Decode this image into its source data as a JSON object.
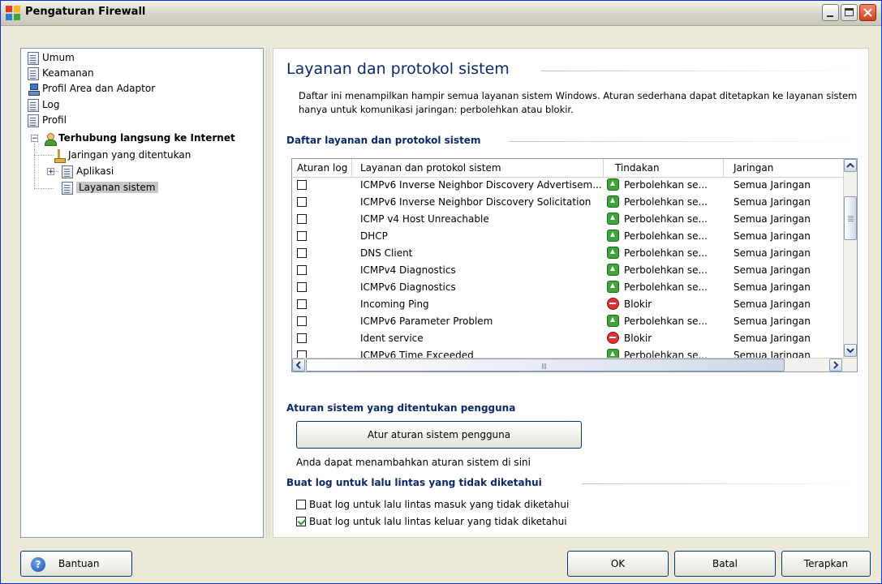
{
  "window": {
    "title": "Pengaturan Firewall"
  },
  "tree": {
    "items": [
      {
        "label": "Umum"
      },
      {
        "label": "Keamanan"
      },
      {
        "label": "Profil Area dan Adaptor"
      },
      {
        "label": "Log"
      },
      {
        "label": "Profil"
      },
      {
        "label": "Terhubung langsung ke Internet"
      },
      {
        "label": "Jaringan yang ditentukan"
      },
      {
        "label": "Aplikasi"
      },
      {
        "label": "Layanan sistem"
      }
    ]
  },
  "main": {
    "title": "Layanan dan protokol sistem",
    "description": "Daftar ini menampilkan hampir semua layanan sistem Windows. Aturan sederhana dapat ditetapkan ke layanan sistem hanya untuk komunikasi jaringan: perbolehkan atau blokir.",
    "list_section": "Daftar layanan dan protokol sistem",
    "columns": [
      "Aturan log",
      "Layanan dan protokol sistem",
      "Tindakan",
      "Jaringan"
    ],
    "rows": [
      {
        "service": "ICMPv6 Inverse Neighbor Discovery Advertisem...",
        "action": "Perbolehkan se...",
        "action_type": "allow",
        "network": "Semua Jaringan"
      },
      {
        "service": "ICMPv6 Inverse Neighbor Discovery Solicitation",
        "action": "Perbolehkan se...",
        "action_type": "allow",
        "network": "Semua Jaringan"
      },
      {
        "service": "ICMP v4 Host Unreachable",
        "action": "Perbolehkan se...",
        "action_type": "allow",
        "network": "Semua Jaringan"
      },
      {
        "service": "DHCP",
        "action": "Perbolehkan se...",
        "action_type": "allow",
        "network": "Semua Jaringan"
      },
      {
        "service": "DNS Client",
        "action": "Perbolehkan se...",
        "action_type": "allow",
        "network": "Semua Jaringan"
      },
      {
        "service": "ICMPv4 Diagnostics",
        "action": "Perbolehkan se...",
        "action_type": "allow",
        "network": "Semua Jaringan"
      },
      {
        "service": "ICMPv6 Diagnostics",
        "action": "Perbolehkan se...",
        "action_type": "allow",
        "network": "Semua Jaringan"
      },
      {
        "service": "Incoming Ping",
        "action": "Blokir",
        "action_type": "block",
        "network": "Semua Jaringan"
      },
      {
        "service": "ICMPv6 Parameter Problem",
        "action": "Perbolehkan se...",
        "action_type": "allow",
        "network": "Semua Jaringan"
      },
      {
        "service": "Ident service",
        "action": "Blokir",
        "action_type": "block",
        "network": "Semua Jaringan"
      },
      {
        "service": "ICMPv6 Time Exceeded",
        "action": "Perbolehkan se...",
        "action_type": "allow",
        "network": "Semua Jaringan"
      }
    ],
    "user_rules_section": "Aturan sistem yang ditentukan pengguna",
    "user_rules_button": "Atur aturan sistem pengguna",
    "user_rules_note": "Anda dapat menambahkan aturan sistem di sini",
    "log_section": "Buat log untuk lalu lintas yang tidak diketahui",
    "log_inbound": {
      "label": "Buat log untuk lalu lintas masuk yang tidak diketahui",
      "checked": false
    },
    "log_outbound": {
      "label": "Buat log untuk lalu lintas keluar yang tidak diketahui",
      "checked": true
    }
  },
  "footer": {
    "help": "Bantuan",
    "ok": "OK",
    "cancel": "Batal",
    "apply": "Terapkan"
  },
  "colors": {
    "title_blue": "#0a2a6a",
    "allow_green": "#3fa43a",
    "block_red": "#dd3333"
  }
}
